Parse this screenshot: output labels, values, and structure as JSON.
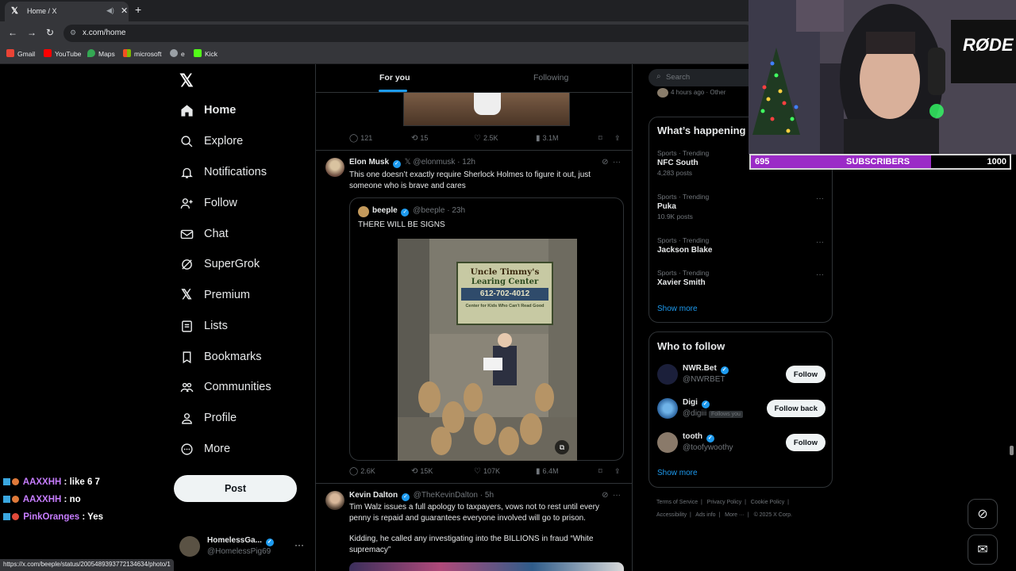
{
  "browser": {
    "tab_title": "Home / X",
    "url": "x.com/home",
    "bookmarks": [
      "Gmail",
      "YouTube",
      "Maps",
      "microsoft",
      "e",
      "Kick"
    ],
    "status_url": "https://x.com/beeple/status/2005489393772134634/photo/1"
  },
  "nav": {
    "items": [
      {
        "label": "Home",
        "icon": "home-icon"
      },
      {
        "label": "Explore",
        "icon": "search-icon"
      },
      {
        "label": "Notifications",
        "icon": "bell-icon"
      },
      {
        "label": "Follow",
        "icon": "follow-icon"
      },
      {
        "label": "Chat",
        "icon": "mail-icon"
      },
      {
        "label": "SuperGrok",
        "icon": "grok-icon"
      },
      {
        "label": "Premium",
        "icon": "x-icon"
      },
      {
        "label": "Lists",
        "icon": "list-icon"
      },
      {
        "label": "Bookmarks",
        "icon": "bookmark-icon"
      },
      {
        "label": "Communities",
        "icon": "communities-icon"
      },
      {
        "label": "Profile",
        "icon": "profile-icon"
      },
      {
        "label": "More",
        "icon": "more-icon"
      }
    ],
    "post_label": "Post",
    "account": {
      "name": "HomelessGa...",
      "handle": "@HomelessPig69"
    }
  },
  "chat": [
    {
      "user": "AAXXHH",
      "msg": "like 6 7"
    },
    {
      "user": "AAXXHH",
      "msg": "no"
    },
    {
      "user": "PinkOranges",
      "msg": "Yes"
    }
  ],
  "feed": {
    "tabs": {
      "for_you": "For you",
      "following": "Following"
    },
    "top_actions": {
      "replies": "121",
      "reposts": "15",
      "likes": "2.5K",
      "views": "3.1M"
    },
    "tweet1": {
      "name": "Elon Musk",
      "meta": "@elonmusk · 12h",
      "text": "This one doesn’t exactly require Sherlock Holmes to figure it out, just someone who is brave and cares",
      "quote": {
        "name": "beeple",
        "meta": "@beeple · 23h",
        "text": "THERE WILL BE SIGNS",
        "sign_line1": "Uncle Timmy's",
        "sign_line2": "Learing Center",
        "sign_phone": "612-702-4012",
        "sign_sub": "Center for Kids Who Can't Read Good"
      },
      "actions": {
        "replies": "2.6K",
        "reposts": "15K",
        "likes": "107K",
        "views": "6.4M"
      }
    },
    "tweet2": {
      "name": "Kevin Dalton",
      "meta": "@TheKevinDalton · 5h",
      "text1": "Tim Walz issues a full apology to taxpayers, vows not to rest until every penny is repaid and guarantees everyone involved will go to prison.",
      "text2": "Kidding, he called any investigating into the BILLIONS in fraud “White supremacy”"
    }
  },
  "right": {
    "search_placeholder": "Search",
    "top_snippet": "4 hours ago · Other",
    "whats_happening_title": "What’s happening",
    "trends": [
      {
        "category": "Sports · Trending",
        "name": "NFC South",
        "count": "4,283 posts"
      },
      {
        "category": "Sports · Trending",
        "name": "Puka",
        "count": "10.9K posts"
      },
      {
        "category": "Sports · Trending",
        "name": "Jackson Blake",
        "count": ""
      },
      {
        "category": "Sports · Trending",
        "name": "Xavier Smith",
        "count": ""
      }
    ],
    "show_more": "Show more",
    "who_to_follow_title": "Who to follow",
    "suggestions": [
      {
        "name": "NWR.Bet",
        "handle": "@NWRBET",
        "button": "Follow",
        "follows_you": ""
      },
      {
        "name": "Digi",
        "handle": "@digiii",
        "button": "Follow back",
        "follows_you": "Follows you"
      },
      {
        "name": "tooth",
        "handle": "@toofywoothy",
        "button": "Follow",
        "follows_you": ""
      }
    ],
    "footer_line1": [
      "Terms of Service",
      "Privacy Policy",
      "Cookie Policy"
    ],
    "footer_line2": [
      "Accessibility",
      "Ads info",
      "More ···",
      "© 2025 X Corp."
    ]
  },
  "stream": {
    "sub_current": "695",
    "sub_label": "SUBSCRIBERS",
    "sub_goal": "1000",
    "sub_progress": 0.695,
    "mic_brand": "RØDE"
  }
}
